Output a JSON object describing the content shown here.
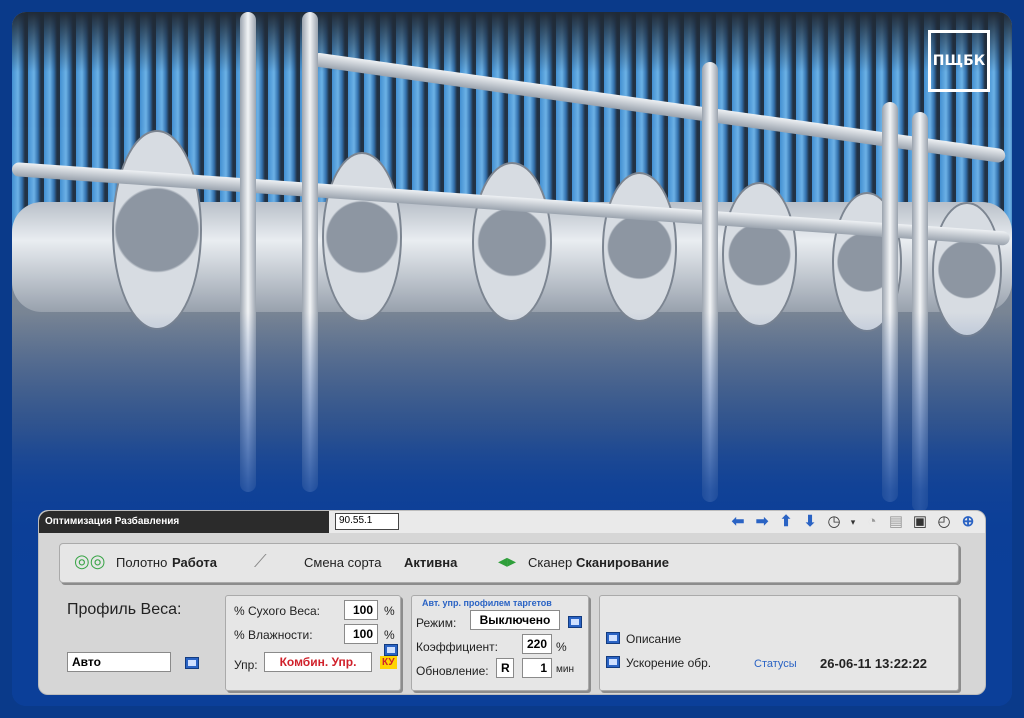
{
  "branding": {
    "logo_text": "ПЩБК"
  },
  "window": {
    "title": "Оптимизация Разбавления",
    "address": "90.55.1"
  },
  "toolbar": {
    "icons": [
      "arrow-left-icon",
      "arrow-right-icon",
      "arrow-up-icon",
      "arrow-down-icon",
      "clock-icon",
      "dropdown-icon",
      "timer-icon",
      "print-icon",
      "camera-icon",
      "clock2-icon",
      "zoom-icon"
    ]
  },
  "status_row": {
    "web_label": "Полотно",
    "web_value": "Работа",
    "grade_label": "Смена сорта",
    "grade_value": "Активна",
    "scanner_label": "Сканер",
    "scanner_value": "Сканирование"
  },
  "profile": {
    "title": "Профиль Веса:",
    "mode_value": "Авто"
  },
  "weights": {
    "dry_label": "% Сухого Веса:",
    "dry_value": "100",
    "dry_unit": "%",
    "moist_label": "% Влажности:",
    "moist_value": "100",
    "moist_unit": "%",
    "ctrl_label": "Упр:",
    "ctrl_value": "Комбин. Упр.",
    "ctrl_badge": "КУ"
  },
  "auto_profile": {
    "header": "Авт. упр. профилем таргетов",
    "mode_label": "Режим:",
    "mode_value": "Выключено",
    "coef_label": "Коэффициент:",
    "coef_value": "220",
    "coef_unit": "%",
    "update_label": "Обновление:",
    "update_btn": "R",
    "update_value": "1",
    "update_unit": "мин"
  },
  "info": {
    "description_label": "Описание",
    "accel_label": "Ускорение обр.",
    "statuses_link": "Статусы",
    "timestamp": "26-06-11 13:22:22"
  },
  "colors": {
    "accent_blue": "#2a63c4",
    "brand_blue": "#0b3f99",
    "alert_red": "#d0202a",
    "badge_yellow": "#ffd400"
  }
}
